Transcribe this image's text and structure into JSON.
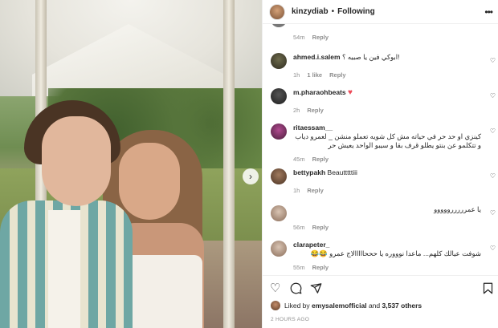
{
  "post": {
    "username": "kinzydiab",
    "follow_label": "Following",
    "more_icon": "more-horizontal-icon",
    "next_icon": "chevron-right-icon"
  },
  "top_meta": {
    "time": "54m",
    "reply": "Reply"
  },
  "comments": [
    {
      "user": "ahmed.i.salem",
      "text": "ابوكي فين يا صبيه ؟!",
      "time": "1h",
      "likes": "1 like",
      "reply": "Reply",
      "rtl": true
    },
    {
      "user": "m.pharaohbeats",
      "text": "",
      "time": "2h",
      "reply": "Reply",
      "emoji": "red-heart"
    },
    {
      "user": "ritaessam__",
      "text": "كينزي او حد حر في حياته مش كل شويه تعملو منشن _ لعمرو دياب و تتكلمو عن بنتو يطلو قرف بقا و سيبو الواحد يعيش حر",
      "time": "45m",
      "reply": "Reply",
      "rtl": true
    },
    {
      "user": "bettypakh",
      "text": "Beautttttiii",
      "time": "1h",
      "reply": "Reply"
    },
    {
      "user": "clarapeter_",
      "text": "يا عمرررررووووو",
      "time": "56m",
      "reply": "Reply",
      "rtl": true
    },
    {
      "user": "clarapeter_",
      "text": "شوفت عيالك كلهم... ماعدا نوووره يا حححااااالاج عمرو 😂😂",
      "time": "55m",
      "reply": "Reply",
      "rtl": true
    }
  ],
  "actions": {
    "like_icon": "heart-icon",
    "comment_icon": "comment-icon",
    "share_icon": "paper-plane-icon",
    "save_icon": "bookmark-icon"
  },
  "likes": {
    "prefix": "Liked by ",
    "user": "emysalemofficial",
    "middle": " and ",
    "others": "3,537 others"
  },
  "timestamp": "2 HOURS AGO",
  "colors": {
    "accent": "#262626",
    "secondary": "#8e8e8e",
    "heart": "#ed4956",
    "border": "#efefef"
  }
}
